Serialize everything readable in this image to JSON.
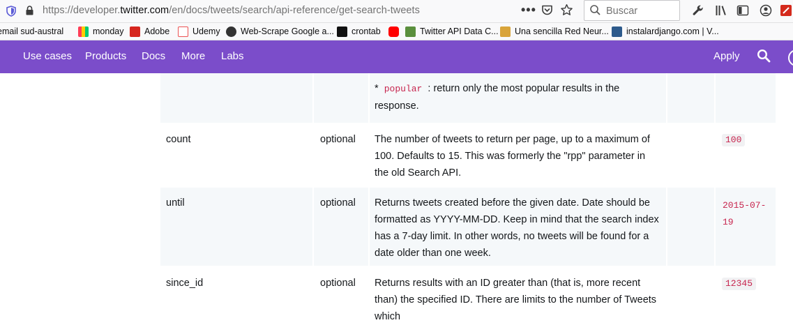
{
  "browser": {
    "url_prefix": "https://developer.",
    "url_domain": "twitter.com",
    "url_path": "/en/docs/tweets/search/api-reference/get-search-tweets",
    "menu_dots": "•••",
    "search_placeholder": "Buscar"
  },
  "bookmarks": [
    {
      "label": "email sud-austral",
      "color": "#c23a2b"
    },
    {
      "label": "monday",
      "color": "#ff3d57"
    },
    {
      "label": "Adobe",
      "color": "#d6251d"
    },
    {
      "label": "Udemy",
      "color": "#ec5252"
    },
    {
      "label": "Web-Scrape Google a...",
      "color": "#333333"
    },
    {
      "label": "crontab",
      "color": "#111111"
    },
    {
      "label": "",
      "color": "#ff0000"
    },
    {
      "label": "Twitter API Data C...",
      "color": "#5a8f3d"
    },
    {
      "label": "Una sencilla Red Neur...",
      "color": "#d9a43a"
    },
    {
      "label": "instalardjango.com | V...",
      "color": "#2d5a8c"
    }
  ],
  "nav": {
    "items": [
      "Use cases",
      "Products",
      "Docs",
      "More",
      "Labs"
    ],
    "apply": "Apply",
    "bg_color": "#7b4dca"
  },
  "table": {
    "rows": [
      {
        "name": "",
        "requirement": "",
        "description_code": "popular",
        "description_prefix": "*",
        "description": ": return only the most popular results in the response.",
        "default": ""
      },
      {
        "name": "count",
        "requirement": "optional",
        "description": "The number of tweets to return per page, up to a maximum of 100. Defaults to 15. This was formerly the \"rpp\" parameter in the old Search API.",
        "default": "100"
      },
      {
        "name": "until",
        "requirement": "optional",
        "description": "Returns tweets created before the given date. Date should be formatted as YYYY-MM-DD. Keep in mind that the search index has a 7-day limit. In other words, no tweets will be found for a date older than one week.",
        "default": "2015-07-19"
      },
      {
        "name": "since_id",
        "requirement": "optional",
        "description": "Returns results with an ID greater than (that is, more recent than) the specified ID. There are limits to the number of Tweets which",
        "default": "12345"
      }
    ]
  }
}
